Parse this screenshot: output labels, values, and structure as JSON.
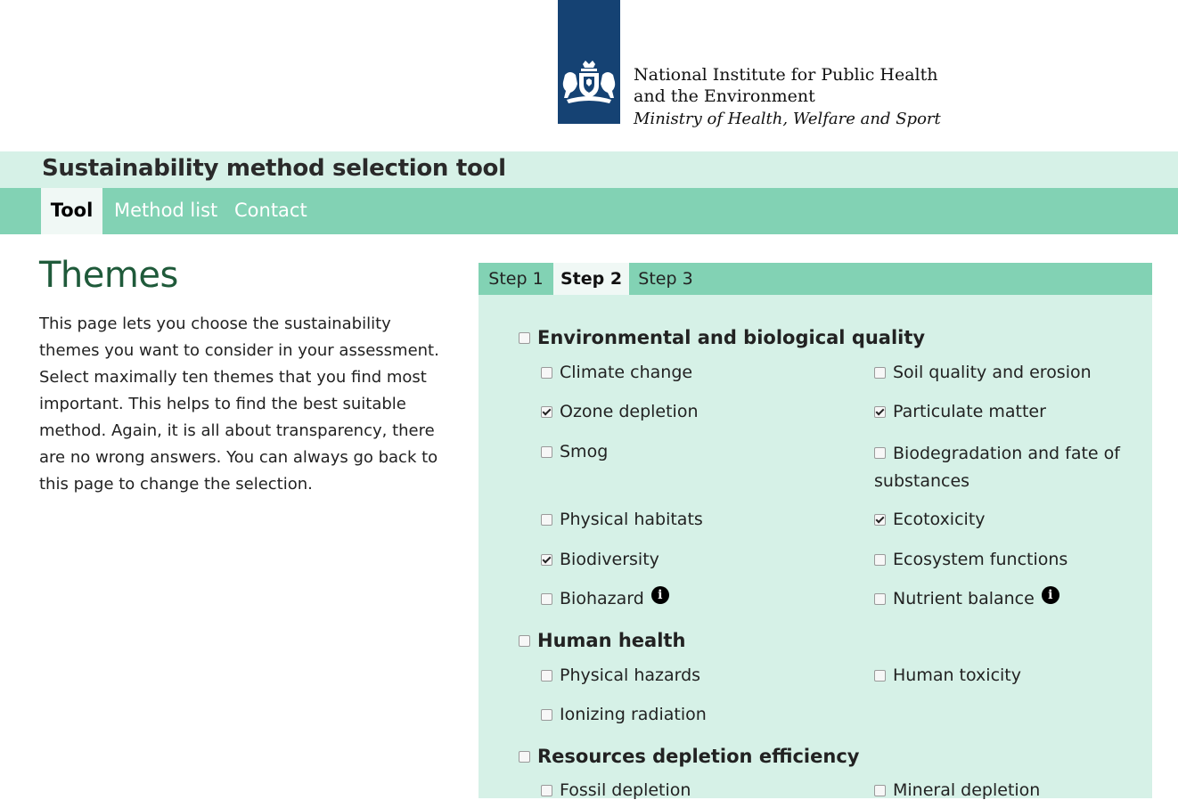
{
  "organization": {
    "line1": "National Institute for Public Health",
    "line2": "and the Environment",
    "line3": "Ministry of Health, Welfare and Sport",
    "brand_color": "#154273"
  },
  "site_title": "Sustainability method selection tool",
  "nav": {
    "tool": "Tool",
    "method_list": "Method list",
    "contact": "Contact",
    "active": "Tool"
  },
  "page": {
    "heading": "Themes",
    "intro": "This page lets you choose the sustainability themes you want to consider in your assessment. Select maximally ten themes that you find most important. This helps to find the best suitable method. Again, it is all about transparency, there are no wrong answers. You can always go back to this page to change the selection."
  },
  "steps": {
    "step1": "Step 1",
    "step2": "Step 2",
    "step3": "Step 3",
    "active": "Step 2"
  },
  "categories": {
    "env": {
      "label": "Environmental and biological quality",
      "checked": false,
      "options": {
        "climate_change": {
          "label": "Climate change",
          "checked": false
        },
        "soil_quality": {
          "label": "Soil quality and erosion",
          "checked": false
        },
        "ozone_depletion": {
          "label": "Ozone depletion",
          "checked": true
        },
        "particulate_matter": {
          "label": "Particulate matter",
          "checked": true
        },
        "smog": {
          "label": "Smog",
          "checked": false
        },
        "biodegradation": {
          "label": "Biodegradation and fate of substances",
          "checked": false
        },
        "physical_habitats": {
          "label": "Physical habitats",
          "checked": false
        },
        "ecotoxicity": {
          "label": "Ecotoxicity",
          "checked": true
        },
        "biodiversity": {
          "label": "Biodiversity",
          "checked": true
        },
        "ecosystem_functions": {
          "label": "Ecosystem functions",
          "checked": false
        },
        "biohazard": {
          "label": "Biohazard",
          "checked": false,
          "info": true
        },
        "nutrient_balance": {
          "label": "Nutrient balance",
          "checked": false,
          "info": true
        }
      }
    },
    "human": {
      "label": "Human health",
      "checked": false,
      "options": {
        "physical_hazards": {
          "label": "Physical hazards",
          "checked": false
        },
        "human_toxicity": {
          "label": "Human toxicity",
          "checked": false
        },
        "ionizing_radiation": {
          "label": "Ionizing radiation",
          "checked": false
        }
      }
    },
    "resources": {
      "label": "Resources depletion efficiency",
      "checked": false,
      "options": {
        "fossil_depletion": {
          "label": "Fossil depletion",
          "checked": false
        },
        "mineral_depletion": {
          "label": "Mineral depletion",
          "checked": false
        }
      }
    }
  },
  "info_glyph": "i",
  "icons": {
    "logo": "royal-crest-icon",
    "checkbox": "checkbox-icon",
    "info": "info-icon"
  },
  "colors": {
    "title_band": "#d6f1e7",
    "nav": "#82d2b4",
    "heading": "#1f5a3a"
  }
}
